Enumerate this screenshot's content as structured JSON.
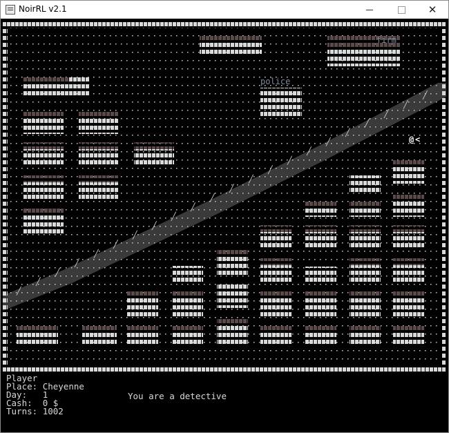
{
  "window": {
    "title": "NoirRL v2.1",
    "minimize_label": "—",
    "maximize_label": "☐",
    "close_label": "✕"
  },
  "map": {
    "labels": {
      "police": "police",
      "firm": "firm"
    },
    "player_glyph": "@",
    "npc_glyph": "<",
    "colors": {
      "background": "#000000",
      "wall": "#d9d9d9",
      "dim_wall": "#5a4a4a",
      "dot": "#cccccc",
      "road": "#3a3a3a",
      "label": "#7a8a9c",
      "player": "#ffffff"
    }
  },
  "status": {
    "title": "Player",
    "place_label": "Place:",
    "place_value": "Cheyenne",
    "day_label": "Day:",
    "day_value": "1",
    "cash_label": "Cash:",
    "cash_value": "0 $",
    "turns_label": "Turns:",
    "turns_value": "1002",
    "message": "You are a detective"
  }
}
